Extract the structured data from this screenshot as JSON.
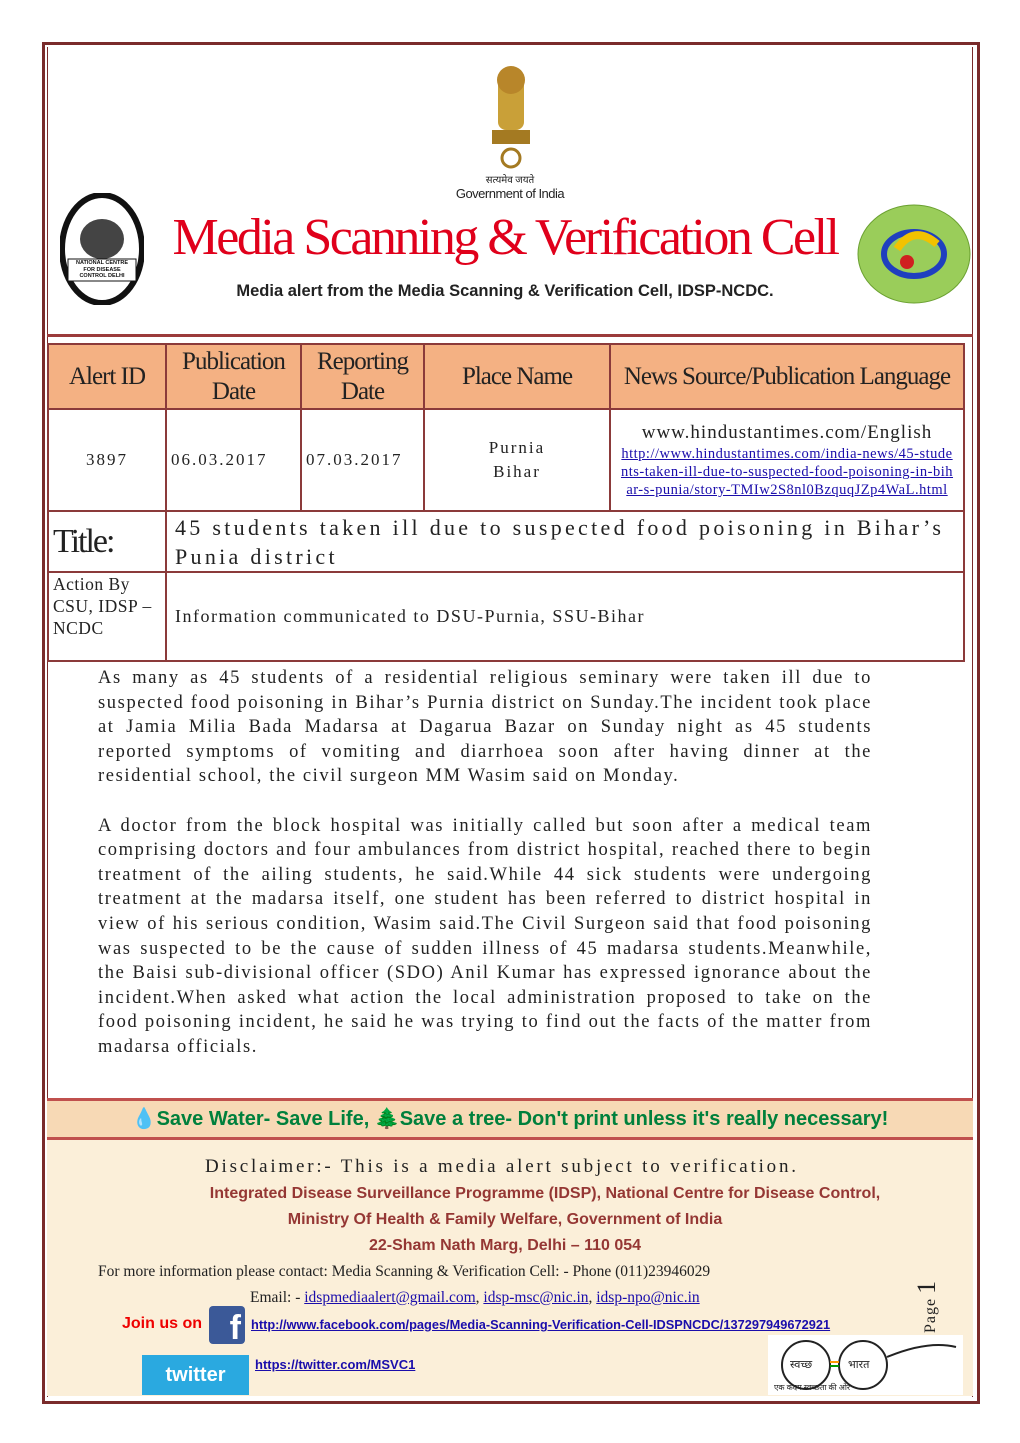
{
  "header": {
    "emblem_caption_hindi": "सत्यमेव जयते",
    "emblem_caption": "Government of India",
    "title": "Media Scanning & Verification Cell",
    "subtitle": "Media alert from the Media Scanning & Verification Cell, IDSP-NCDC.",
    "left_logo_text": "NATIONAL CENTRE FOR DISEASE CONTROL DELHI",
    "title_color": "#e0001b"
  },
  "table": {
    "headers": [
      "Alert  ID",
      "Publication Date",
      "Reporting Date",
      "Place Name",
      "News Source/Publication Language"
    ],
    "alert_id": "3897",
    "publication_date": "06.03.2017",
    "reporting_date": "07.03.2017",
    "place": "Purnia",
    "state": "Bihar",
    "source": "www.hindustantimes.com/English",
    "link": "http://www.hindustantimes.com/india-news/45-students-taken-ill-due-to-suspected-food-poisoning-in-bihar-s-punia/story-TMIw2S8nl0BzquqJZp4WaL.html",
    "title_label": "Title:",
    "title": "45 students taken ill due to suspected food poisoning in Bihar’s Punia district",
    "action_label": "Action By CSU, IDSP –NCDC",
    "action": "Information communicated to DSU-Purnia, SSU-Bihar"
  },
  "body": [
    "As many as 45 students of a residential religious seminary were taken ill due to suspected food poisoning in Bihar’s Purnia district on Sunday.The incident took place at Jamia Milia Bada Madarsa at Dagarua Bazar on Sunday night as 45 students reported symptoms of vomiting and diarrhoea soon after having dinner at the residential school, the civil surgeon MM Wasim said on Monday.",
    "A doctor from the block hospital was initially called but soon after a medical team comprising doctors and four ambulances from district hospital, reached there to begin treatment of the ailing students, he said.While 44 sick students were undergoing treatment at the madarsa itself, one student has been referred to district hospital in view of his serious condition, Wasim said.The Civil Surgeon said that food poisoning was suspected to be the cause of sudden illness of 45 madarsa students.Meanwhile, the Baisi sub-divisional officer (SDO) Anil Kumar has expressed ignorance about the incident.When asked what action the local administration proposed to take on the food poisoning incident, he said he was trying to find out the facts of the matter from madarsa officials."
  ],
  "footer": {
    "band_1": "Save Water- Save Life,",
    "band_2": "Save a tree- Don't print unless it's really necessary!",
    "disclaimer": "Disclaimer:- This is a media alert subject to verification.",
    "org_1": "Integrated Disease Surveillance Programme (IDSP), National Centre for Disease Control,",
    "org_2": "Ministry Of Health & Family Welfare, Government of India",
    "address": "22-Sham Nath Marg, Delhi – 110 054",
    "contact": "For more information please contact: Media Scanning & Verification Cell: - Phone (011)23946029",
    "email_label": "Email: -",
    "emails": [
      "idspmediaalert@gmail.com",
      "idsp-msc@nic.in",
      "idsp-npo@nic.in"
    ],
    "join": "Join us on",
    "facebook": "http://www.facebook.com/pages/Media-Scanning-Verification-Cell-IDSPNCDC/137297949672921",
    "twitter_logo": "twitter",
    "twitter": "https://twitter.com/MSVC1",
    "page_label": "Page",
    "page_number": "1",
    "swachh_1": "स्वच्छ",
    "swachh_2": "भारत",
    "swachh_tag": "एक कदम स्वच्छता की ओर"
  }
}
